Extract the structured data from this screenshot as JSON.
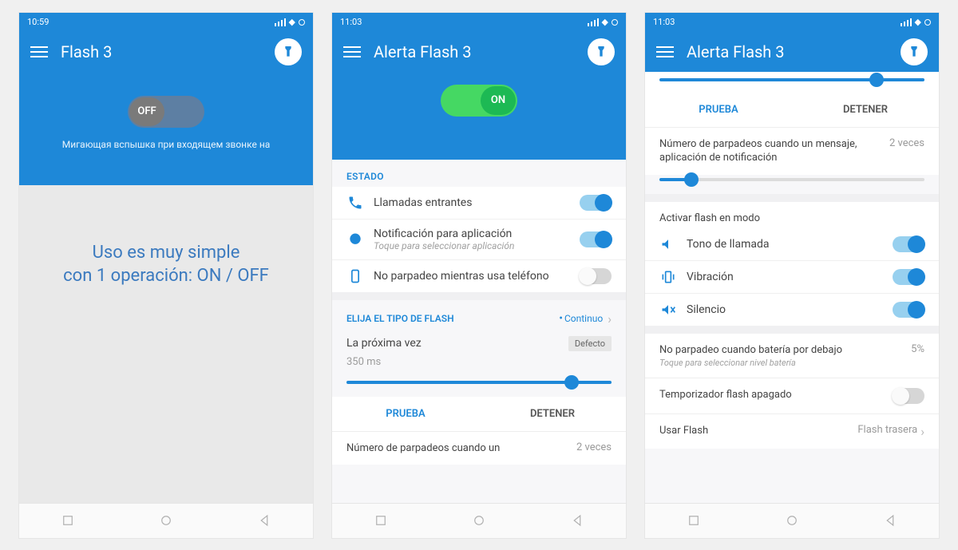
{
  "screen1": {
    "statusbar_time": "10:59",
    "title": "Flash 3",
    "toggle_label": "OFF",
    "hero_text": "Мигающая вспышка при входящем звонке на",
    "promo_line1": "Uso es muy simple",
    "promo_line2": "con 1 operación: ON / OFF"
  },
  "screen2": {
    "statusbar_time": "11:03",
    "title": "Alerta Flash 3",
    "toggle_label": "ON",
    "section_estado": "ESTADO",
    "row_calls": "Llamadas entrantes",
    "row_notif": "Notificación para aplicación",
    "row_notif_sub": "Toque para seleccionar aplicación",
    "row_nophone": "No parpadeo mientras usa teléfono",
    "section_flash_type": "ELIJA EL TIPO DE FLASH",
    "flash_type_value": "Continuo",
    "next_time": "La próxima vez",
    "default_badge": "Defecto",
    "ms": "350 ms",
    "slider_percent": 85,
    "tab_prueba": "PRUEBA",
    "tab_detener": "DETENER",
    "blinks_label": "Número de parpadeos cuando un",
    "blinks_value": "2 veces"
  },
  "screen3": {
    "statusbar_time": "11:03",
    "title": "Alerta Flash 3",
    "top_slider_percent": 82,
    "tab_prueba": "PRUEBA",
    "tab_detener": "DETENER",
    "blinks_label": "Número de parpadeos cuando un mensaje, aplicación de notificación",
    "blinks_value": "2 veces",
    "blinks_slider_percent": 12,
    "mode_label": "Activar flash en modo",
    "mode_ring": "Tono de llamada",
    "mode_vibrate": "Vibración",
    "mode_silence": "Silencio",
    "battery_label": "No parpadeo cuando batería por debajo",
    "battery_sub": "Toque para seleccionar nivel batería",
    "battery_value": "5%",
    "timer_label": "Temporizador flash apagado",
    "use_flash_label": "Usar Flash",
    "use_flash_value": "Flash trasera"
  }
}
